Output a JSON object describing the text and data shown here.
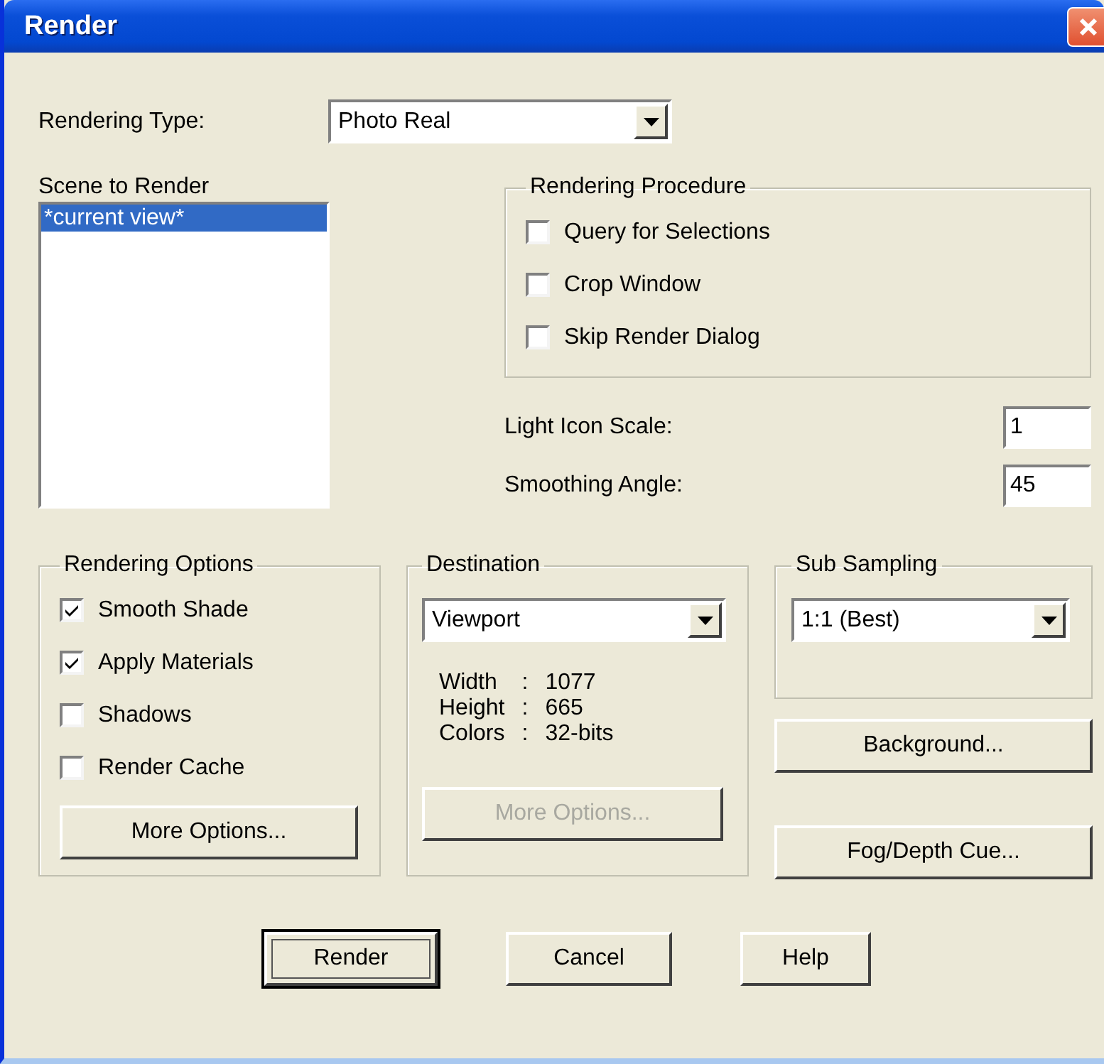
{
  "window": {
    "title": "Render"
  },
  "rendering_type": {
    "label": "Rendering Type:",
    "value": "Photo Real"
  },
  "scene": {
    "label": "Scene to Render",
    "items": [
      {
        "label": "*current view*",
        "selected": true
      }
    ]
  },
  "rendering_procedure": {
    "title": "Rendering Procedure",
    "options": [
      {
        "label": "Query for Selections",
        "checked": false
      },
      {
        "label": "Crop Window",
        "checked": false
      },
      {
        "label": "Skip Render Dialog",
        "checked": false
      }
    ]
  },
  "fields": [
    {
      "label": "Light Icon Scale:",
      "value": "1"
    },
    {
      "label": "Smoothing Angle:",
      "value": "45"
    }
  ],
  "rendering_options": {
    "title": "Rendering Options",
    "options": [
      {
        "label": "Smooth Shade",
        "checked": true
      },
      {
        "label": "Apply Materials",
        "checked": true
      },
      {
        "label": "Shadows",
        "checked": false
      },
      {
        "label": "Render Cache",
        "checked": false
      }
    ],
    "button": {
      "label": "More Options...",
      "disabled": false
    }
  },
  "destination": {
    "title": "Destination",
    "value": "Viewport",
    "info": [
      {
        "name": "Width",
        "separator": ":",
        "value": "1077"
      },
      {
        "name": "Height",
        "separator": ":",
        "value": "665"
      },
      {
        "name": "Colors",
        "separator": ":",
        "value": "32-bits"
      }
    ],
    "button": {
      "label": "More Options...",
      "disabled": true
    }
  },
  "sub_sampling": {
    "title": "Sub Sampling",
    "value": "1:1 (Best)"
  },
  "side_buttons": [
    "Background...",
    "Fog/Depth Cue..."
  ],
  "buttons": [
    {
      "label": "Render",
      "default": true
    },
    {
      "label": "Cancel",
      "default": false
    },
    {
      "label": "Help",
      "default": false
    }
  ]
}
